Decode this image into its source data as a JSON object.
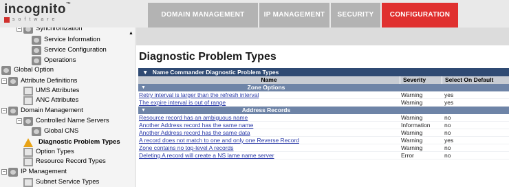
{
  "brand": {
    "name": "incognito",
    "tm": "™",
    "tagline": "software"
  },
  "nav": {
    "items": [
      {
        "label": "DOMAIN MANAGEMENT",
        "active": false
      },
      {
        "label": "IP MANAGEMENT",
        "active": false
      },
      {
        "label": "SECURITY",
        "active": false
      },
      {
        "label": "CONFIGURATION",
        "active": true
      }
    ]
  },
  "sidebar": {
    "items": [
      {
        "label": "Synchronization",
        "icon": "folder-icon"
      },
      {
        "label": "Service Information",
        "icon": "gear-icon"
      },
      {
        "label": "Service Configuration",
        "icon": "gear-icon"
      },
      {
        "label": "Operations",
        "icon": "gear-icon"
      },
      {
        "label": "Global Option",
        "icon": "folder-icon"
      },
      {
        "label": "Attribute Definitions",
        "icon": "folder-icon"
      },
      {
        "label": "UMS Attributes",
        "icon": "document-icon"
      },
      {
        "label": "ANC Attributes",
        "icon": "document-icon"
      },
      {
        "label": "Domain Management",
        "icon": "folder-icon"
      },
      {
        "label": "Controlled Name Servers",
        "icon": "folder-icon"
      },
      {
        "label": "Global CNS",
        "icon": "gear-icon"
      },
      {
        "label": "Diagnostic Problem Types",
        "icon": "warning-icon"
      },
      {
        "label": "Option Types",
        "icon": "document-icon"
      },
      {
        "label": "Resource Record Types",
        "icon": "document-icon"
      },
      {
        "label": "IP Management",
        "icon": "folder-icon"
      },
      {
        "label": "Subnet Service Types",
        "icon": "document-icon"
      }
    ]
  },
  "main": {
    "title": "Diagnostic Problem Types",
    "table": {
      "caption": "Name Commander Diagnostic Problem Types",
      "columns": {
        "name": "Name",
        "severity": "Severity",
        "select_default": "Select On Default"
      },
      "groups": [
        {
          "label": "Zone Options",
          "rows": [
            {
              "name": "Retry interval is larger than the refresh interval",
              "severity": "Warning",
              "select": "yes"
            },
            {
              "name": "The expire interval is out of range",
              "severity": "Warning",
              "select": "yes"
            }
          ]
        },
        {
          "label": "Address Records",
          "rows": [
            {
              "name": "Resource record has an ambiguous name",
              "severity": "Warning",
              "select": "no"
            },
            {
              "name": "Another Address record has the same name",
              "severity": "Information",
              "select": "no"
            },
            {
              "name": "Another Address record has the same data",
              "severity": "Warning",
              "select": "no"
            },
            {
              "name": "A record does not match to one and only one Reverse Record",
              "severity": "Warning",
              "select": "yes"
            },
            {
              "name": "Zone contains no top-level A records",
              "severity": "Warning",
              "select": "no"
            },
            {
              "name": "Deleting A record will create a NS lame name server",
              "severity": "Error",
              "select": "no"
            }
          ]
        }
      ]
    }
  },
  "colors": {
    "accent": "#e0302f",
    "caption_bar": "#2f4a73",
    "group_bar": "#6e84a7",
    "link": "#2a3aa8"
  }
}
